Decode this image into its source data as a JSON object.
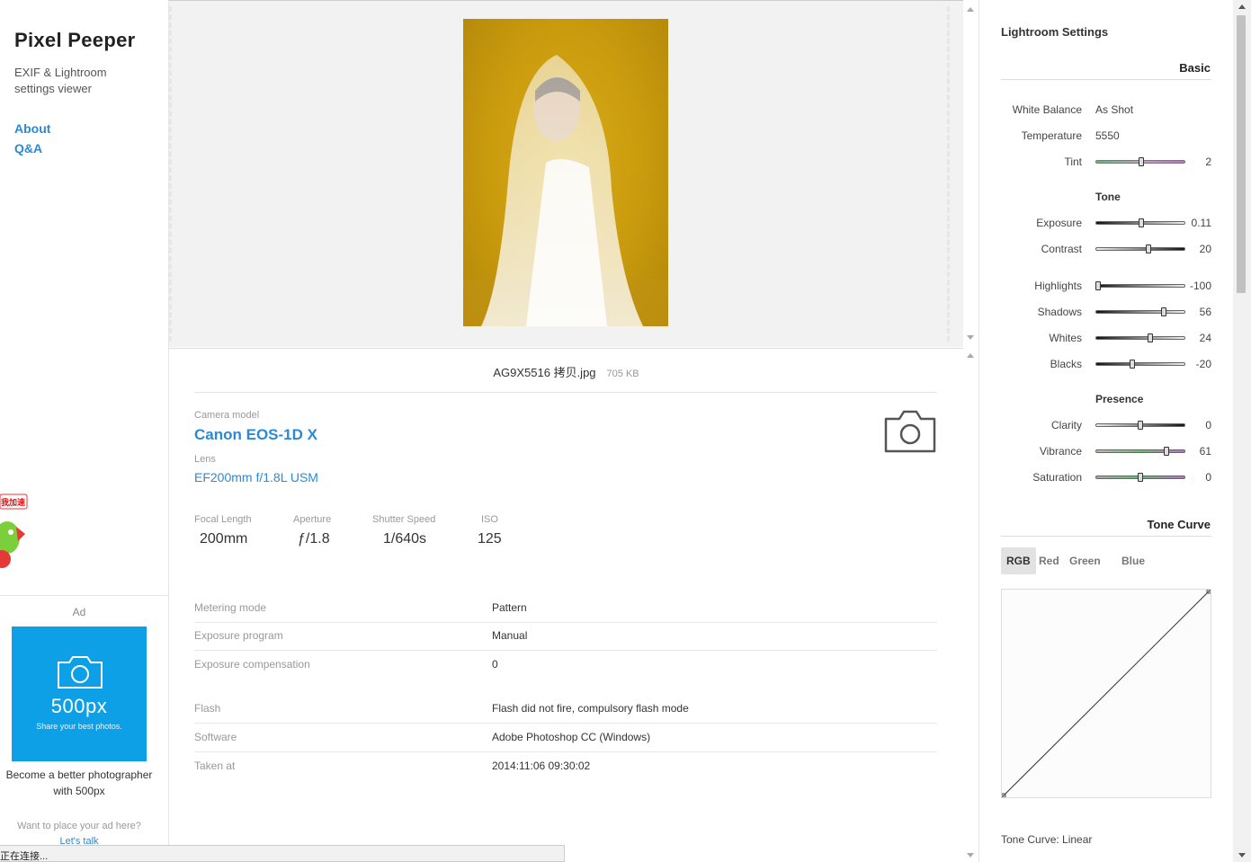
{
  "sidebar": {
    "brand": "Pixel Peeper",
    "tagline": "EXIF & Lightroom settings viewer",
    "nav": [
      "About",
      "Q&A"
    ],
    "ad": {
      "label": "Ad",
      "logo": "500px",
      "slogan": "Share your best photos.",
      "text": "Become a better photographer with 500px",
      "cta": "Want to place your ad here?",
      "cta_link": "Let's talk"
    },
    "mascot_badge": "我加速"
  },
  "status_bar": "正在连接...",
  "file": {
    "name": "AG9X5516 拷贝.jpg",
    "size": "705 KB"
  },
  "camera": {
    "model_label": "Camera model",
    "model": "Canon EOS-1D X",
    "lens_label": "Lens",
    "lens": "EF200mm f/1.8L USM",
    "stats": [
      {
        "label": "Focal Length",
        "value": "200mm"
      },
      {
        "label": "Aperture",
        "value": "ƒ/1.8"
      },
      {
        "label": "Shutter Speed",
        "value": "1/640s"
      },
      {
        "label": "ISO",
        "value": "125"
      }
    ]
  },
  "exif": [
    {
      "key": "Metering mode",
      "value": "Pattern"
    },
    {
      "key": "Exposure program",
      "value": "Manual"
    },
    {
      "key": "Exposure compensation",
      "value": "0"
    },
    {
      "key": "Flash",
      "value": "Flash did not fire, compulsory flash mode"
    },
    {
      "key": "Software",
      "value": "Adobe Photoshop CC (Windows)"
    },
    {
      "key": "Taken at",
      "value": "2014:11:06 09:30:02"
    }
  ],
  "lightroom": {
    "title": "Lightroom Settings",
    "basic_title": "Basic",
    "white_balance": {
      "label": "White Balance",
      "value": "As Shot"
    },
    "temperature": {
      "label": "Temperature",
      "value": "5550"
    },
    "tint": {
      "label": "Tint",
      "value": "2",
      "fraction": 0.51
    },
    "tone_title": "Tone",
    "tone": [
      {
        "label": "Exposure",
        "value": "0.11",
        "fraction": 0.51
      },
      {
        "label": "Contrast",
        "value": "20",
        "fraction": 0.6
      }
    ],
    "tone2": [
      {
        "label": "Highlights",
        "value": "-100",
        "fraction": 0.0
      },
      {
        "label": "Shadows",
        "value": "56",
        "fraction": 0.78
      },
      {
        "label": "Whites",
        "value": "24",
        "fraction": 0.62
      },
      {
        "label": "Blacks",
        "value": "-20",
        "fraction": 0.4
      }
    ],
    "presence_title": "Presence",
    "presence": [
      {
        "label": "Clarity",
        "value": "0",
        "fraction": 0.5
      },
      {
        "label": "Vibrance",
        "value": "61",
        "fraction": 0.81
      },
      {
        "label": "Saturation",
        "value": "0",
        "fraction": 0.5
      }
    ],
    "tone_curve_title": "Tone Curve",
    "curve_tabs": [
      "RGB",
      "Red",
      "Green",
      "Blue"
    ],
    "curve_caption": "Tone Curve: Linear"
  }
}
